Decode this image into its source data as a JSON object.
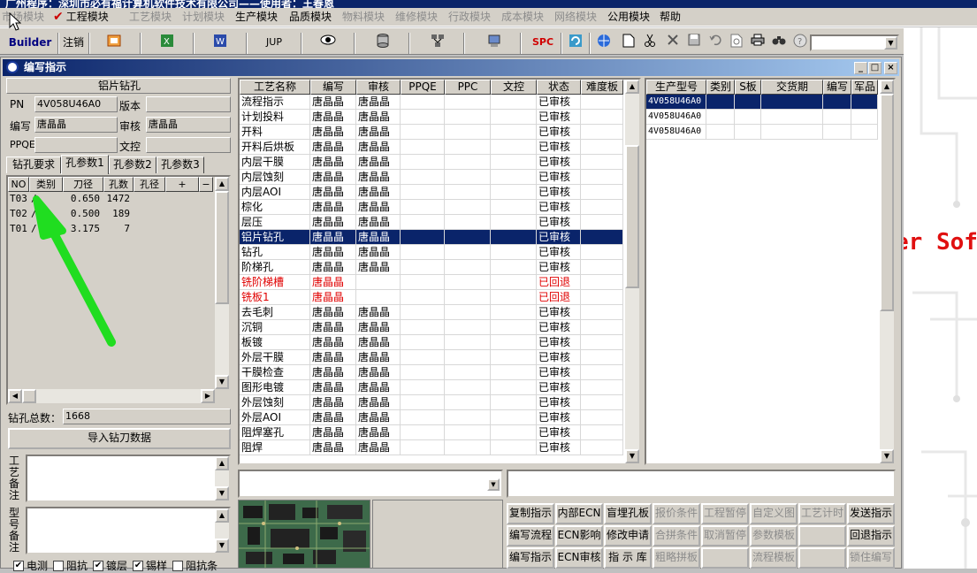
{
  "app": {
    "title": "广州程序：深圳市必有福计算机软件技术有限公司——使用者：王春恩",
    "logo_text": "er Sof"
  },
  "menu": [
    {
      "label": "市场模块",
      "disabled": true
    },
    {
      "label": "工程模块",
      "disabled": false,
      "checked": true
    },
    {
      "label": "工艺模块",
      "disabled": true
    },
    {
      "label": "计划模块",
      "disabled": true
    },
    {
      "label": "生产模块",
      "disabled": false
    },
    {
      "label": "品质模块",
      "disabled": false
    },
    {
      "label": "物料模块",
      "disabled": true
    },
    {
      "label": "维修模块",
      "disabled": true
    },
    {
      "label": "行政模块",
      "disabled": true
    },
    {
      "label": "成本模块",
      "disabled": true
    },
    {
      "label": "网络模块",
      "disabled": true
    },
    {
      "label": "公用模块",
      "disabled": false
    },
    {
      "label": "帮助",
      "disabled": false
    }
  ],
  "toolbar": {
    "builder": "Builder",
    "logout": "注销",
    "jup": "JUP",
    "spc": "SPC"
  },
  "window": {
    "title": "编写指示"
  },
  "left": {
    "process_name": "铝片钻孔",
    "pn_label": "PN",
    "pn_value": "4V058U46A0",
    "version_label": "版本",
    "version_value": "",
    "author_label": "编写",
    "author_value": "唐晶晶",
    "reviewer_label": "审核",
    "reviewer_value": "唐晶晶",
    "ppqe_label": "PPQE",
    "ppqe_value": "",
    "doc_label": "文控",
    "doc_value": "",
    "tabs": [
      "钻孔要求",
      "孔参数1",
      "孔参数2",
      "孔参数3"
    ],
    "active_tab": 1,
    "hole_columns": [
      "NO",
      "类别",
      "刀径",
      "孔数",
      "孔径",
      "+",
      "−"
    ],
    "holes": [
      {
        "no": "T03",
        "type": "/",
        "dia": "0.650",
        "count": "1472"
      },
      {
        "no": "T02",
        "type": "/",
        "dia": "0.500",
        "count": "189"
      },
      {
        "no": "T01",
        "type": "/",
        "dia": "3.175",
        "count": "7"
      }
    ],
    "total_label": "钻孔总数：",
    "total_value": "1668",
    "import_button": "导入钻刀数据",
    "process_note_label": "工艺备注",
    "model_note_label": "型号备注",
    "checkboxes": [
      {
        "label": "电测",
        "checked": true
      },
      {
        "label": "阻抗",
        "checked": false
      },
      {
        "label": "镀层",
        "checked": true
      },
      {
        "label": "锡样",
        "checked": true
      },
      {
        "label": "阻抗条",
        "checked": false
      }
    ]
  },
  "process_grid": {
    "columns": [
      "工艺名称",
      "编写",
      "审核",
      "PPQE",
      "PPC",
      "文控",
      "状态",
      "难度板"
    ],
    "rows": [
      {
        "name": "流程指示",
        "author": "唐晶晶",
        "reviewer": "唐晶晶",
        "status": "已审核"
      },
      {
        "name": "计划投料",
        "author": "唐晶晶",
        "reviewer": "唐晶晶",
        "status": "已审核"
      },
      {
        "name": "开料",
        "author": "唐晶晶",
        "reviewer": "唐晶晶",
        "status": "已审核"
      },
      {
        "name": "开料后烘板",
        "author": "唐晶晶",
        "reviewer": "唐晶晶",
        "status": "已审核"
      },
      {
        "name": "内层干膜",
        "author": "唐晶晶",
        "reviewer": "唐晶晶",
        "status": "已审核"
      },
      {
        "name": "内层蚀刻",
        "author": "唐晶晶",
        "reviewer": "唐晶晶",
        "status": "已审核"
      },
      {
        "name": "内层AOI",
        "author": "唐晶晶",
        "reviewer": "唐晶晶",
        "status": "已审核"
      },
      {
        "name": "棕化",
        "author": "唐晶晶",
        "reviewer": "唐晶晶",
        "status": "已审核"
      },
      {
        "name": "层压",
        "author": "唐晶晶",
        "reviewer": "唐晶晶",
        "status": "已审核"
      },
      {
        "name": "铝片钻孔",
        "author": "唐晶晶",
        "reviewer": "唐晶晶",
        "status": "已审核",
        "selected": true
      },
      {
        "name": "钻孔",
        "author": "唐晶晶",
        "reviewer": "唐晶晶",
        "status": "已审核"
      },
      {
        "name": "阶梯孔",
        "author": "唐晶晶",
        "reviewer": "唐晶晶",
        "status": "已审核"
      },
      {
        "name": "铣阶梯槽",
        "author": "唐晶晶",
        "reviewer": "",
        "status": "已回退",
        "red": true
      },
      {
        "name": "铣板1",
        "author": "唐晶晶",
        "reviewer": "",
        "status": "已回退",
        "red": true
      },
      {
        "name": "去毛刺",
        "author": "唐晶晶",
        "reviewer": "唐晶晶",
        "status": "已审核"
      },
      {
        "name": "沉铜",
        "author": "唐晶晶",
        "reviewer": "唐晶晶",
        "status": "已审核"
      },
      {
        "name": "板镀",
        "author": "唐晶晶",
        "reviewer": "唐晶晶",
        "status": "已审核"
      },
      {
        "name": "外层干膜",
        "author": "唐晶晶",
        "reviewer": "唐晶晶",
        "status": "已审核"
      },
      {
        "name": "干膜检查",
        "author": "唐晶晶",
        "reviewer": "唐晶晶",
        "status": "已审核"
      },
      {
        "name": "图形电镀",
        "author": "唐晶晶",
        "reviewer": "唐晶晶",
        "status": "已审核"
      },
      {
        "name": "外层蚀刻",
        "author": "唐晶晶",
        "reviewer": "唐晶晶",
        "status": "已审核"
      },
      {
        "name": "外层AOI",
        "author": "唐晶晶",
        "reviewer": "唐晶晶",
        "status": "已审核"
      },
      {
        "name": "阻焊塞孔",
        "author": "唐晶晶",
        "reviewer": "唐晶晶",
        "status": "已审核"
      },
      {
        "name": "阻焊",
        "author": "唐晶晶",
        "reviewer": "唐晶晶",
        "status": "已审核"
      }
    ]
  },
  "model_grid": {
    "columns": [
      "生产型号",
      "类别",
      "S板",
      "交货期",
      "编写",
      "军品"
    ],
    "rows": [
      {
        "model": "4V058U46A0",
        "selected": true
      },
      {
        "model": "4V058U46A0"
      },
      {
        "model": "4V058U46A0"
      }
    ]
  },
  "action_buttons": [
    [
      {
        "label": "复制指示",
        "enabled": true
      },
      {
        "label": "内部ECN",
        "enabled": true
      },
      {
        "label": "盲埋孔板",
        "enabled": true
      },
      {
        "label": "报价条件",
        "enabled": false
      },
      {
        "label": "工程暂停",
        "enabled": false
      },
      {
        "label": "自定义图",
        "enabled": false
      },
      {
        "label": "工艺计时",
        "enabled": false
      },
      {
        "label": "发送指示",
        "enabled": true
      }
    ],
    [
      {
        "label": "编写流程",
        "enabled": true
      },
      {
        "label": "ECN影响",
        "enabled": true
      },
      {
        "label": "修改申请",
        "enabled": true
      },
      {
        "label": "合拼条件",
        "enabled": false
      },
      {
        "label": "取消暂停",
        "enabled": false
      },
      {
        "label": "参数模板",
        "enabled": false
      },
      {
        "label": "",
        "enabled": false
      },
      {
        "label": "回退指示",
        "enabled": true
      }
    ],
    [
      {
        "label": "编写指示",
        "enabled": true
      },
      {
        "label": "ECN审核",
        "enabled": true
      },
      {
        "label": "指 示 库",
        "enabled": true
      },
      {
        "label": "粗略拼板",
        "enabled": false
      },
      {
        "label": "",
        "enabled": false
      },
      {
        "label": "流程模板",
        "enabled": false
      },
      {
        "label": "",
        "enabled": false
      },
      {
        "label": "锁住编写",
        "enabled": false
      }
    ]
  ]
}
